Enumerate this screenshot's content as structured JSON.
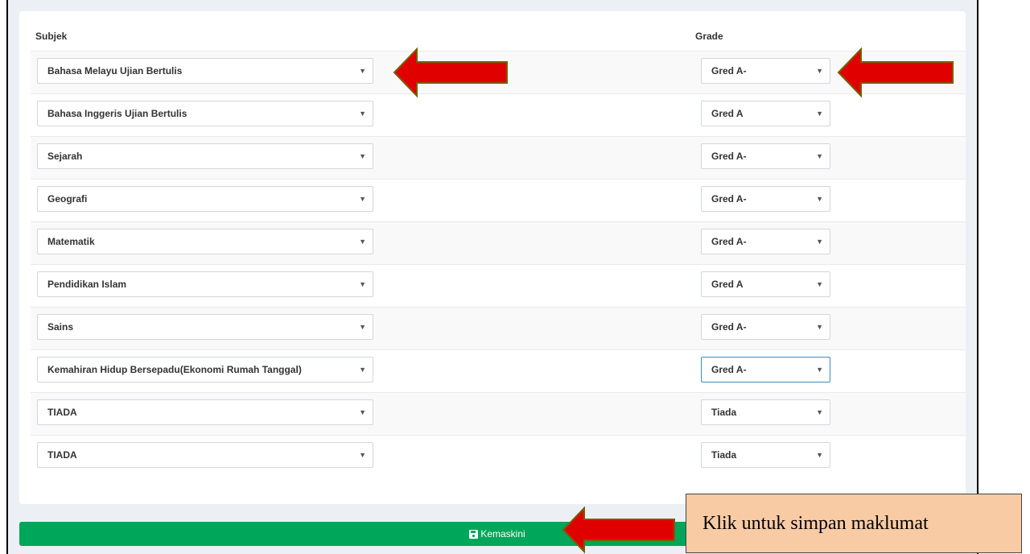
{
  "headers": {
    "subject": "Subjek",
    "grade": "Grade"
  },
  "rows": [
    {
      "subject": "Bahasa Melayu Ujian Bertulis",
      "grade": "Gred A-"
    },
    {
      "subject": "Bahasa Inggeris Ujian Bertulis",
      "grade": "Gred A"
    },
    {
      "subject": "Sejarah",
      "grade": "Gred A-"
    },
    {
      "subject": "Geografi",
      "grade": "Gred A-"
    },
    {
      "subject": "Matematik",
      "grade": "Gred A-"
    },
    {
      "subject": "Pendidikan Islam",
      "grade": "Gred A"
    },
    {
      "subject": "Sains",
      "grade": "Gred A-"
    },
    {
      "subject": "Kemahiran Hidup Bersepadu(Ekonomi Rumah Tanggal)",
      "grade": "Gred A-"
    },
    {
      "subject": "TIADA",
      "grade": "Tiada"
    },
    {
      "subject": "TIADA",
      "grade": "Tiada"
    }
  ],
  "focused_row": 7,
  "caret": "▼",
  "button": {
    "label": "Kemaskini",
    "icon": "save-icon",
    "color": "#00a65a"
  },
  "callout": {
    "text": "Klik untuk simpan maklumat",
    "color": "#f8cba4"
  },
  "annotation_arrow_color": "#e00000"
}
